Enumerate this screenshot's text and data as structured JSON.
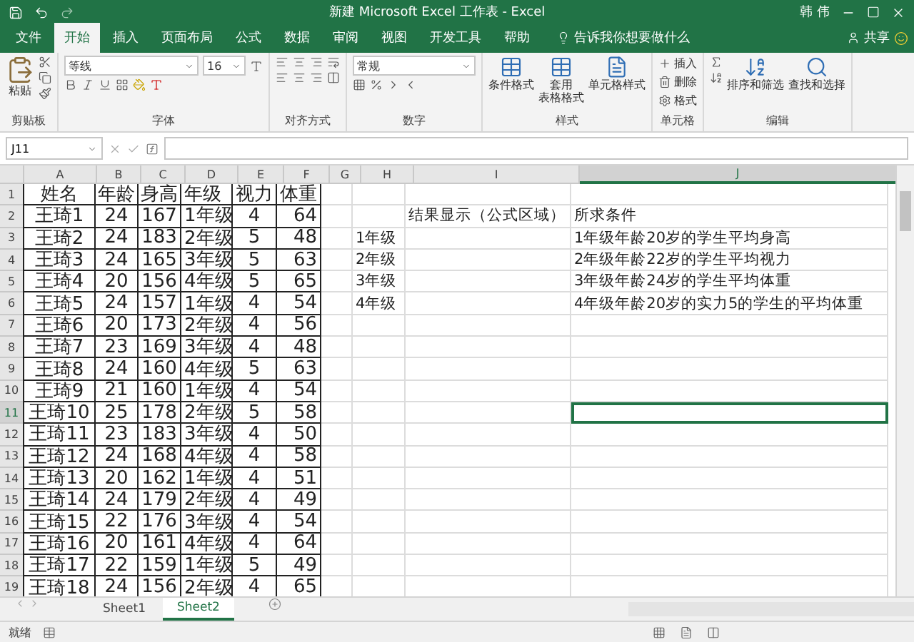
{
  "window": {
    "title": "新建 Microsoft Excel 工作表 - Excel",
    "user": "韩 伟"
  },
  "menu_tabs": [
    {
      "label": "文件",
      "selected": false
    },
    {
      "label": "开始",
      "selected": true
    },
    {
      "label": "插入",
      "selected": false
    },
    {
      "label": "页面布局",
      "selected": false
    },
    {
      "label": "公式",
      "selected": false
    },
    {
      "label": "数据",
      "selected": false
    },
    {
      "label": "审阅",
      "selected": false
    },
    {
      "label": "视图",
      "selected": false
    },
    {
      "label": "开发工具",
      "selected": false
    },
    {
      "label": "帮助",
      "selected": false
    }
  ],
  "tell_me": "告诉我你想要做什么",
  "share": "共享",
  "ribbon_groups": [
    {
      "kind": "clipboard",
      "label": "剪贴板",
      "buttons": [
        "粘贴"
      ]
    },
    {
      "kind": "font",
      "label": "字体",
      "font": "等线",
      "size": "16"
    },
    {
      "kind": "align",
      "label": "对齐方式"
    },
    {
      "kind": "number",
      "label": "数字",
      "format": "常规"
    },
    {
      "kind": "styles",
      "label": "样式",
      "buttons": [
        [
          "条件格式"
        ],
        [
          "套用",
          "表格格式"
        ],
        [
          "单元格样式"
        ]
      ]
    },
    {
      "kind": "cells",
      "label": "单元格",
      "buttons": [
        "插入",
        "删除",
        "格式"
      ]
    },
    {
      "kind": "editing",
      "label": "编辑",
      "buttons": [
        "排序和筛选",
        "查找和选择"
      ]
    }
  ],
  "name_box": "J11",
  "columns": [
    {
      "label": "A",
      "selected": false
    },
    {
      "label": "B",
      "selected": false
    },
    {
      "label": "C",
      "selected": false
    },
    {
      "label": "D",
      "selected": false
    },
    {
      "label": "E",
      "selected": false
    },
    {
      "label": "F",
      "selected": false
    },
    {
      "label": "G",
      "selected": false
    },
    {
      "label": "H",
      "selected": false
    },
    {
      "label": "I",
      "selected": false
    },
    {
      "label": "J",
      "selected": true
    }
  ],
  "rows": [
    {
      "number": "1",
      "selected": false,
      "cells": [
        "姓名",
        "年龄",
        "身高",
        "年级",
        "视力",
        "体重",
        null,
        null,
        null,
        null
      ]
    },
    {
      "number": "2",
      "selected": false,
      "cells": [
        "王琦1",
        "24",
        "167",
        "1年级",
        "4",
        "64",
        null,
        null,
        "结果显示（公式区域）",
        "所求条件"
      ]
    },
    {
      "number": "3",
      "selected": false,
      "cells": [
        "王琦2",
        "24",
        "183",
        "2年级",
        "5",
        "48",
        null,
        "1年级",
        null,
        "1年级年龄20岁的学生平均身高"
      ]
    },
    {
      "number": "4",
      "selected": false,
      "cells": [
        "王琦3",
        "24",
        "165",
        "3年级",
        "5",
        "63",
        null,
        "2年级",
        null,
        "2年级年龄22岁的学生平均视力"
      ]
    },
    {
      "number": "5",
      "selected": false,
      "cells": [
        "王琦4",
        "20",
        "156",
        "4年级",
        "5",
        "65",
        null,
        "3年级",
        null,
        "3年级年龄24岁的学生平均体重"
      ]
    },
    {
      "number": "6",
      "selected": false,
      "cells": [
        "王琦5",
        "24",
        "157",
        "1年级",
        "4",
        "54",
        null,
        "4年级",
        null,
        "4年级年龄20岁的实力5的学生的平均体重"
      ]
    },
    {
      "number": "7",
      "selected": false,
      "cells": [
        "王琦6",
        "20",
        "173",
        "2年级",
        "4",
        "56",
        null,
        null,
        null,
        null
      ]
    },
    {
      "number": "8",
      "selected": false,
      "cells": [
        "王琦7",
        "23",
        "169",
        "3年级",
        "4",
        "48",
        null,
        null,
        null,
        null
      ]
    },
    {
      "number": "9",
      "selected": false,
      "cells": [
        "王琦8",
        "24",
        "160",
        "4年级",
        "5",
        "63",
        null,
        null,
        null,
        null
      ]
    },
    {
      "number": "10",
      "selected": false,
      "cells": [
        "王琦9",
        "21",
        "160",
        "1年级",
        "4",
        "54",
        null,
        null,
        null,
        null
      ]
    },
    {
      "number": "11",
      "selected": true,
      "cells": [
        "王琦10",
        "25",
        "178",
        "2年级",
        "5",
        "58",
        null,
        null,
        null,
        null
      ]
    },
    {
      "number": "12",
      "selected": false,
      "cells": [
        "王琦11",
        "23",
        "183",
        "3年级",
        "4",
        "50",
        null,
        null,
        null,
        null
      ]
    },
    {
      "number": "13",
      "selected": false,
      "cells": [
        "王琦12",
        "24",
        "168",
        "4年级",
        "4",
        "58",
        null,
        null,
        null,
        null
      ]
    },
    {
      "number": "14",
      "selected": false,
      "cells": [
        "王琦13",
        "20",
        "162",
        "1年级",
        "4",
        "51",
        null,
        null,
        null,
        null
      ]
    },
    {
      "number": "15",
      "selected": false,
      "cells": [
        "王琦14",
        "24",
        "179",
        "2年级",
        "4",
        "49",
        null,
        null,
        null,
        null
      ]
    },
    {
      "number": "16",
      "selected": false,
      "cells": [
        "王琦15",
        "22",
        "176",
        "3年级",
        "4",
        "54",
        null,
        null,
        null,
        null
      ]
    },
    {
      "number": "17",
      "selected": false,
      "cells": [
        "王琦16",
        "20",
        "161",
        "4年级",
        "4",
        "64",
        null,
        null,
        null,
        null
      ]
    },
    {
      "number": "18",
      "selected": false,
      "cells": [
        "王琦17",
        "22",
        "159",
        "1年级",
        "5",
        "49",
        null,
        null,
        null,
        null
      ]
    },
    {
      "number": "19",
      "selected": false,
      "cells": [
        "王琦18",
        "24",
        "156",
        "2年级",
        "4",
        "65",
        null,
        null,
        null,
        null
      ]
    }
  ],
  "sheets": [
    {
      "label": "Sheet1",
      "selected": false
    },
    {
      "label": "Sheet2",
      "selected": true
    }
  ],
  "status": "就绪"
}
